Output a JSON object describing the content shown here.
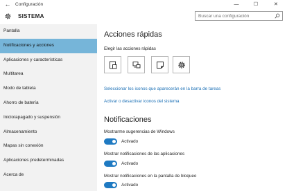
{
  "window": {
    "title": "Configuración",
    "back_glyph": "←",
    "minimize_glyph": "—",
    "maximize_glyph": "☐",
    "close_glyph": "✕"
  },
  "header": {
    "title": "SISTEMA",
    "icon": "gear-icon"
  },
  "search": {
    "placeholder": "Buscar una configuración",
    "icon": "search-icon"
  },
  "colors": {
    "accent": "#1f7ac2",
    "active_nav": "#76b5d9",
    "link": "#1a6fb5",
    "sidebar_bg": "#f2f2f2"
  },
  "sidebar": {
    "items": [
      {
        "label": "Pantalla"
      },
      {
        "label": "Notificaciones y acciones",
        "active": true
      },
      {
        "label": "Aplicaciones y características"
      },
      {
        "label": "Multitarea"
      },
      {
        "label": "Modo de tableta"
      },
      {
        "label": "Ahorro de batería"
      },
      {
        "label": "Inicio/apagado y suspensión"
      },
      {
        "label": "Almacenamiento"
      },
      {
        "label": "Mapas sin conexión"
      },
      {
        "label": "Aplicaciones predeterminadas"
      },
      {
        "label": "Acerca de"
      }
    ]
  },
  "quick_actions": {
    "title": "Acciones rápidas",
    "subtitle": "Elegir las acciones rápidas",
    "tiles": [
      {
        "icon": "tablet-mode-icon"
      },
      {
        "icon": "connect-icon"
      },
      {
        "icon": "note-icon"
      },
      {
        "icon": "settings-icon"
      }
    ],
    "link_select": "Seleccionar los iconos que aparecerán en la barra de tareas",
    "link_toggle": "Activar o desactivar iconos del sistema"
  },
  "notifications": {
    "title": "Notificaciones",
    "settings": [
      {
        "label": "Mostrarme sugerencias de Windows",
        "state": "Activado"
      },
      {
        "label": "Mostrar notificaciones de las aplicaciones",
        "state": "Activado"
      },
      {
        "label": "Mostrar notificaciones en la pantalla de bloqueo",
        "state": "Activado"
      }
    ]
  }
}
